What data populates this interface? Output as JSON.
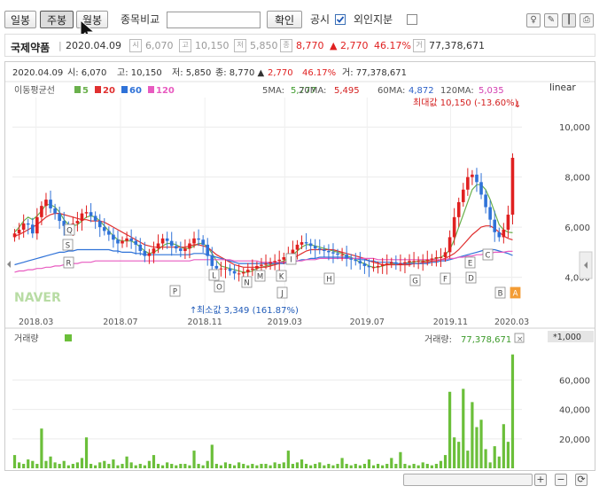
{
  "toolbar": {
    "period_tabs": [
      "일봉",
      "주봉",
      "월봉"
    ],
    "compare_label": "종목비교",
    "compare_placeholder": "",
    "confirm_label": "확인",
    "disclosure_label": "공시",
    "foreign_label": "외인지분"
  },
  "stock": {
    "name": "국제약품",
    "date": "2020.04.09",
    "open": "6,070",
    "high": "10,150",
    "low": "5,850",
    "close": "8,770",
    "change": "▲ 2,770",
    "change_pct": "46.17%",
    "volume": "77,378,671"
  },
  "chart_header": {
    "line1_date": "2020.04.09",
    "line1_open": "시: 6,070",
    "line1_high": "고: 10,150",
    "line1_low": "저: 5,850",
    "line1_close": "종: 8,770 ▲",
    "line1_change": "2,770",
    "line1_pct": "46.17%",
    "line1_volume": "거: 77,378,671",
    "ma_title": "이동평균선",
    "ma_legend": [
      {
        "label": "5",
        "color": "#6ab04c"
      },
      {
        "label": "20",
        "color": "#e03030"
      },
      {
        "label": "60",
        "color": "#2f72d8"
      },
      {
        "label": "120",
        "color": "#e85bc0"
      }
    ],
    "ma_values": [
      {
        "label": "5MA:",
        "value": "5,777",
        "color": "#3c9a2a"
      },
      {
        "label": "20MA:",
        "value": "5,495",
        "color": "#d42020"
      },
      {
        "label": "60MA:",
        "value": "4,872",
        "color": "#2f62c8"
      },
      {
        "label": "120MA:",
        "value": "5,035",
        "color": "#d33fb1"
      }
    ],
    "scale_label": "linear",
    "max_label": "최대값 10,150 (-13.60%)",
    "min_label": "최소값 3,349 (161.87%)",
    "watermark": "NAVER",
    "volume_title": "거래량",
    "volume_value_label": "거래량:",
    "volume_value": "77,378,671",
    "volume_unit": "*1,000"
  },
  "colors": {
    "up": "#e02020",
    "down": "#2f72d8",
    "ma5": "#6ab04c",
    "ma20": "#e03030",
    "ma60": "#2f72d8",
    "ma120": "#e85bc0",
    "volume": "#6bbf3a"
  },
  "chart_data": [
    {
      "type": "line",
      "title": "",
      "xlabel": "",
      "ylabel": "",
      "scale": "linear",
      "ylim": [
        3100,
        11000
      ],
      "yticks": [
        4000,
        6000,
        8000,
        10000
      ],
      "ytick_labels": [
        "4,000",
        "6,000",
        "8,000",
        "10,000"
      ],
      "xticks": [
        "2018.03",
        "2018.07",
        "2018.11",
        "2019.03",
        "2019.07",
        "2019.11",
        "2020.03"
      ],
      "xtick_fracs": [
        0.047,
        0.215,
        0.383,
        0.542,
        0.706,
        0.872,
        0.994
      ],
      "candles_close": [
        5750,
        5900,
        6150,
        6100,
        5750,
        6400,
        6850,
        7100,
        6750,
        6550,
        6250,
        6050,
        5900,
        6150,
        6250,
        6550,
        6600,
        6450,
        6250,
        6000,
        5850,
        5700,
        5500,
        5350,
        5450,
        5550,
        5450,
        5300,
        5050,
        4850,
        4950,
        5150,
        5350,
        5550,
        5450,
        5250,
        5150,
        5050,
        5150,
        5350,
        5550,
        5500,
        5300,
        4850,
        4450,
        4350,
        4350,
        4350,
        4250,
        4150,
        4150,
        4200,
        4300,
        4350,
        4450,
        4500,
        4550,
        4600,
        4650,
        4700,
        4800,
        4950,
        5100,
        5300,
        5400,
        5350,
        5250,
        5150,
        5100,
        5050,
        5000,
        4950,
        4900,
        4900,
        4750,
        4700,
        4650,
        4550,
        4450,
        4400,
        4400,
        4450,
        4500,
        4550,
        4600,
        4550,
        4550,
        4600,
        4650,
        4650,
        4650,
        4650,
        4700,
        4750,
        4800,
        4800,
        5000,
        5600,
        6400,
        7000,
        7500,
        8000,
        8100,
        7800,
        7300,
        6800,
        6300,
        5800,
        5600,
        5900,
        6500,
        8770
      ],
      "ma_series": [
        {
          "name": "5",
          "values": [
            5800,
            6000,
            6250,
            6400,
            6300,
            6450,
            6650,
            6900,
            6900,
            6800,
            6600,
            6300,
            6100,
            6050,
            6100,
            6250,
            6400,
            6450,
            6400,
            6250,
            6050,
            5850,
            5650,
            5500,
            5450,
            5450,
            5450,
            5350,
            5200,
            5050,
            4950,
            5000,
            5100,
            5250,
            5350,
            5350,
            5300,
            5200,
            5150,
            5150,
            5250,
            5350,
            5350,
            5200,
            4950,
            4650,
            4450,
            4400,
            4350,
            4300,
            4250,
            4200,
            4200,
            4250,
            4350,
            4400,
            4450,
            4500,
            4550,
            4600,
            4650,
            4750,
            4900,
            5050,
            5200,
            5300,
            5300,
            5250,
            5200,
            5150,
            5100,
            5050,
            5000,
            4950,
            4850,
            4800,
            4700,
            4600,
            4550,
            4450,
            4400,
            4400,
            4450,
            4500,
            4550,
            4550,
            4550,
            4550,
            4600,
            4600,
            4650,
            4650,
            4650,
            4700,
            4750,
            4800,
            4900,
            5100,
            5500,
            6000,
            6500,
            7000,
            7500,
            7700,
            7700,
            7500,
            7100,
            6600,
            6100,
            5900,
            5800,
            5777
          ]
        },
        {
          "name": "20",
          "values": [
            5650,
            5700,
            5800,
            5900,
            6000,
            6100,
            6250,
            6400,
            6500,
            6550,
            6550,
            6500,
            6450,
            6400,
            6350,
            6300,
            6300,
            6250,
            6250,
            6250,
            6200,
            6100,
            6000,
            5900,
            5800,
            5700,
            5600,
            5500,
            5400,
            5300,
            5250,
            5200,
            5200,
            5200,
            5200,
            5200,
            5200,
            5200,
            5200,
            5250,
            5300,
            5300,
            5250,
            5200,
            5050,
            4900,
            4800,
            4700,
            4600,
            4500,
            4450,
            4400,
            4400,
            4400,
            4400,
            4400,
            4400,
            4450,
            4500,
            4550,
            4600,
            4650,
            4750,
            4850,
            4950,
            5050,
            5100,
            5100,
            5100,
            5100,
            5100,
            5100,
            5050,
            5000,
            4950,
            4900,
            4850,
            4800,
            4750,
            4650,
            4600,
            4550,
            4500,
            4500,
            4500,
            4500,
            4500,
            4500,
            4500,
            4550,
            4550,
            4600,
            4600,
            4650,
            4650,
            4700,
            4750,
            4850,
            4950,
            5100,
            5300,
            5500,
            5700,
            5850,
            6000,
            6050,
            6050,
            5950,
            5800,
            5650,
            5550,
            5495
          ]
        },
        {
          "name": "60",
          "values": [
            4500,
            4550,
            4600,
            4650,
            4700,
            4750,
            4800,
            4850,
            4900,
            4950,
            5000,
            5000,
            5050,
            5050,
            5100,
            5100,
            5100,
            5100,
            5100,
            5100,
            5100,
            5100,
            5050,
            5050,
            5000,
            5000,
            5000,
            4950,
            4950,
            4900,
            4900,
            4900,
            4900,
            4900,
            4900,
            4900,
            4900,
            4900,
            4900,
            4900,
            4950,
            4950,
            4950,
            4900,
            4850,
            4800,
            4750,
            4700,
            4650,
            4600,
            4550,
            4550,
            4550,
            4550,
            4550,
            4550,
            4550,
            4550,
            4550,
            4550,
            4550,
            4600,
            4600,
            4650,
            4700,
            4700,
            4750,
            4750,
            4800,
            4800,
            4800,
            4800,
            4800,
            4800,
            4800,
            4750,
            4750,
            4700,
            4700,
            4650,
            4650,
            4600,
            4600,
            4600,
            4600,
            4550,
            4550,
            4550,
            4550,
            4550,
            4550,
            4550,
            4550,
            4600,
            4600,
            4650,
            4650,
            4700,
            4750,
            4800,
            4850,
            4900,
            4950,
            5000,
            5050,
            5100,
            5100,
            5100,
            5050,
            5000,
            4950,
            4872
          ]
        },
        {
          "name": "120",
          "values": [
            4200,
            4250,
            4250,
            4300,
            4300,
            4350,
            4350,
            4400,
            4400,
            4450,
            4450,
            4500,
            4500,
            4550,
            4550,
            4600,
            4600,
            4600,
            4650,
            4650,
            4650,
            4650,
            4650,
            4650,
            4650,
            4650,
            4650,
            4650,
            4650,
            4650,
            4650,
            4650,
            4650,
            4650,
            4650,
            4650,
            4650,
            4650,
            4650,
            4650,
            4700,
            4700,
            4700,
            4700,
            4700,
            4700,
            4700,
            4700,
            4700,
            4650,
            4650,
            4650,
            4650,
            4650,
            4650,
            4600,
            4600,
            4600,
            4600,
            4600,
            4600,
            4600,
            4650,
            4650,
            4650,
            4700,
            4700,
            4700,
            4750,
            4750,
            4750,
            4750,
            4750,
            4750,
            4750,
            4750,
            4750,
            4750,
            4750,
            4750,
            4750,
            4700,
            4700,
            4700,
            4700,
            4700,
            4700,
            4700,
            4700,
            4700,
            4700,
            4700,
            4700,
            4700,
            4700,
            4700,
            4700,
            4750,
            4750,
            4800,
            4800,
            4850,
            4850,
            4900,
            4900,
            4950,
            4950,
            5000,
            5000,
            5000,
            5035,
            5035
          ]
        }
      ],
      "annotations": [
        {
          "label": "최대값 10,150 (-13.60%)",
          "x": "2020.04",
          "y": 10150
        },
        {
          "label": "최소값 3,349 (161.87%)",
          "x": "2018.10",
          "y": 3349
        }
      ],
      "disclosure_markers": [
        "S",
        "Q",
        "R",
        "P",
        "O",
        "L",
        "N",
        "M",
        "K",
        "J",
        "I",
        "H",
        "G",
        "F",
        "D",
        "E",
        "C",
        "B",
        "A"
      ]
    },
    {
      "type": "bar",
      "title": "거래량",
      "ylabel": "*1,000",
      "ylim": [
        0,
        82000
      ],
      "yticks": [
        20000,
        40000,
        60000
      ],
      "ytick_labels": [
        "20,000",
        "40,000",
        "60,000"
      ],
      "values": [
        9000,
        4000,
        3000,
        6000,
        5000,
        3000,
        27000,
        5000,
        8000,
        4000,
        3000,
        5000,
        2000,
        3000,
        4000,
        7000,
        21000,
        3000,
        2000,
        4000,
        5000,
        3000,
        6000,
        2000,
        3000,
        8000,
        4000,
        2000,
        3000,
        2000,
        5000,
        9000,
        3000,
        2000,
        4000,
        3000,
        2000,
        3000,
        3000,
        2000,
        12000,
        3000,
        2000,
        5000,
        16000,
        3000,
        2000,
        4000,
        3000,
        2000,
        4000,
        3000,
        2000,
        3000,
        2000,
        3000,
        3000,
        2000,
        4000,
        3000,
        4000,
        12000,
        3000,
        4000,
        6000,
        3000,
        2000,
        3000,
        4000,
        2000,
        3000,
        2000,
        3000,
        7000,
        3000,
        2000,
        3000,
        2000,
        3000,
        6000,
        2000,
        3000,
        2000,
        3000,
        7000,
        3000,
        11000,
        3000,
        2000,
        3000,
        2000,
        4000,
        3000,
        2000,
        3000,
        5000,
        9000,
        52000,
        21000,
        18000,
        54000,
        12000,
        45000,
        28000,
        33000,
        13000,
        4000,
        15000,
        8000,
        30000,
        18000,
        77378
      ]
    }
  ]
}
